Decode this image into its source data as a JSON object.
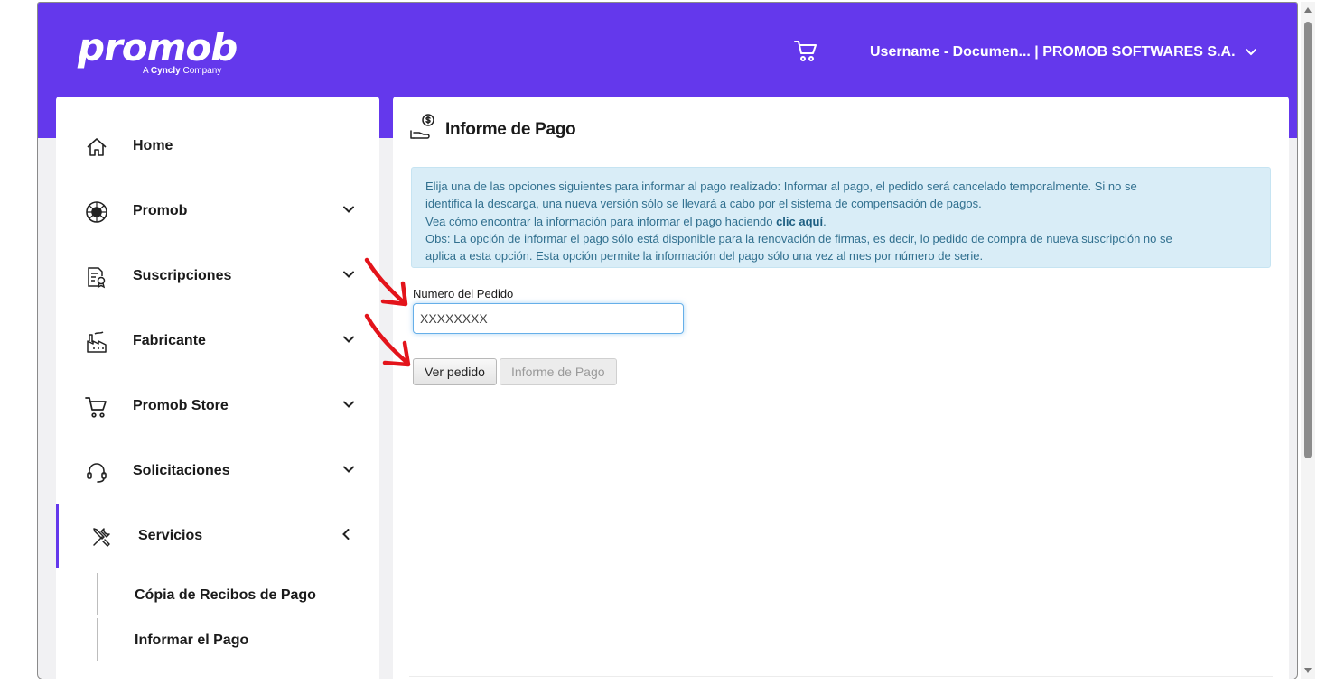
{
  "header": {
    "logo_text": "promob",
    "logo_tag_prefix": "A",
    "logo_tag_brand": "Cyncly",
    "logo_tag_suffix": "Company",
    "cart_icon": "cart-icon",
    "user_label": "Username - Documen... | PROMOB SOFTWARES S.A."
  },
  "sidebar": {
    "items": [
      {
        "label": "Home",
        "icon": "home-icon"
      },
      {
        "label": "Promob",
        "icon": "promob-icon"
      },
      {
        "label": "Suscripciones",
        "icon": "subscription-icon"
      },
      {
        "label": "Fabricante",
        "icon": "factory-icon"
      },
      {
        "label": "Promob Store",
        "icon": "cart-icon"
      },
      {
        "label": "Solicitaciones",
        "icon": "headset-icon"
      },
      {
        "label": "Servicios",
        "icon": "tools-icon"
      }
    ],
    "sub_items": [
      {
        "label": "Cópia de Recibos de Pago"
      },
      {
        "label": "Informar el Pago"
      }
    ]
  },
  "main": {
    "title": "Informe de Pago",
    "info": {
      "line1": "Elija una de las opciones siguientes para informar al pago realizado: Informar al pago, el pedido será cancelado temporalmente. Si no se",
      "line2": "identifica la descarga, una nueva versión sólo se llevará a cabo por el sistema de compensación de pagos.",
      "line3_prefix": "Vea cómo encontrar la información para informar el pago haciendo ",
      "line3_link": "clic aquí",
      "line3_suffix": ".",
      "line4": "Obs: La opción de informar el pago sólo está disponible para la renovación de firmas, es decir, lo pedido de compra de nueva suscripción no se",
      "line5": "aplica a esta opción. Esta opción permite la información del pago sólo una vez al mes por número de serie."
    },
    "order_field": {
      "label": "Numero del Pedido",
      "value": "XXXXXXXX"
    },
    "buttons": {
      "view": "Ver pedido",
      "report": "Informe de Pago"
    }
  },
  "colors": {
    "brand": "#6438ec",
    "info_bg": "#d9edf7",
    "info_text": "#31708f",
    "annotation_arrow": "#e3141b"
  }
}
